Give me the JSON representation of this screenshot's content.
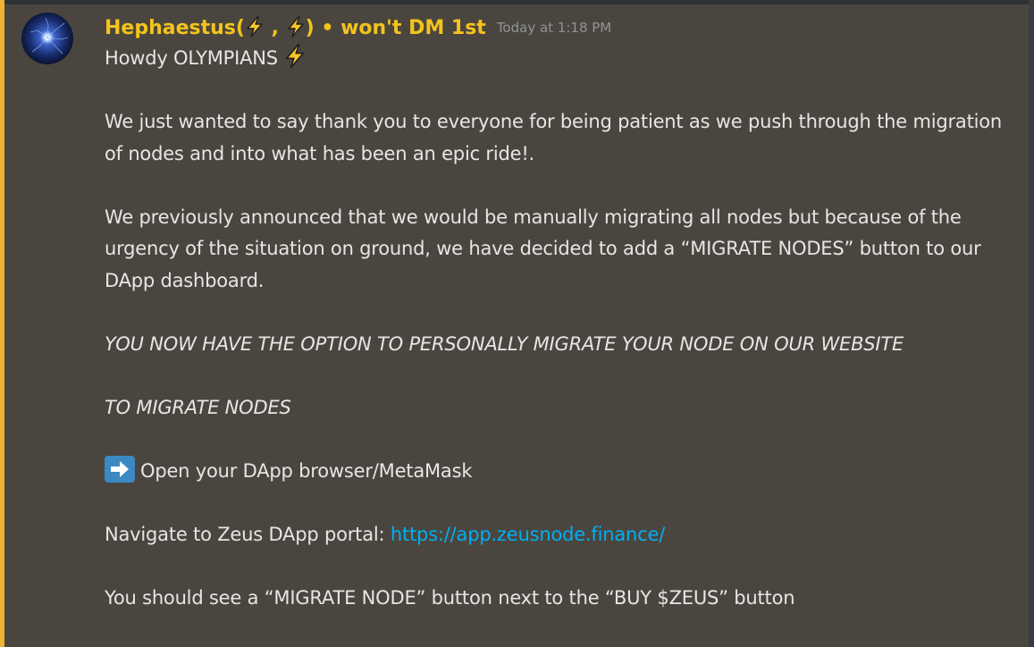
{
  "message": {
    "author": "Hephaestus(",
    "author_sep": " , ",
    "author_close": ")",
    "author_suffix": " • won't DM 1st",
    "timestamp": "Today at 1:18 PM",
    "greeting": "Howdy OLYMPIANS ",
    "para1": "We just wanted to say thank you to everyone for being patient as we push through the migration of nodes and into what has been an epic ride!.",
    "para2": "We previously announced that we would be manually migrating all nodes but because of the urgency of the situation on ground, we have decided to add a “MIGRATE NODES” button to our DApp dashboard.",
    "para3": "YOU NOW HAVE THE OPTION TO PERSONALLY MIGRATE YOUR NODE ON OUR WEBSITE",
    "para4": "TO MIGRATE NODES",
    "step1": "Open your DApp browser/MetaMask",
    "step2_prefix": "Navigate to Zeus DApp portal: ",
    "step2_link": "https://app.zeusnode.finance/",
    "step3": "You should see a “MIGRATE NODE” button next to the “BUY $ZEUS” button"
  },
  "icons": {
    "bolt": "high-voltage-icon",
    "arrow": "right-arrow-icon"
  },
  "colors": {
    "background": "#4a463f",
    "accent_stripe": "#f0b232",
    "username": "#f4c31c",
    "link": "#00aff4",
    "timestamp": "#8f9296"
  }
}
